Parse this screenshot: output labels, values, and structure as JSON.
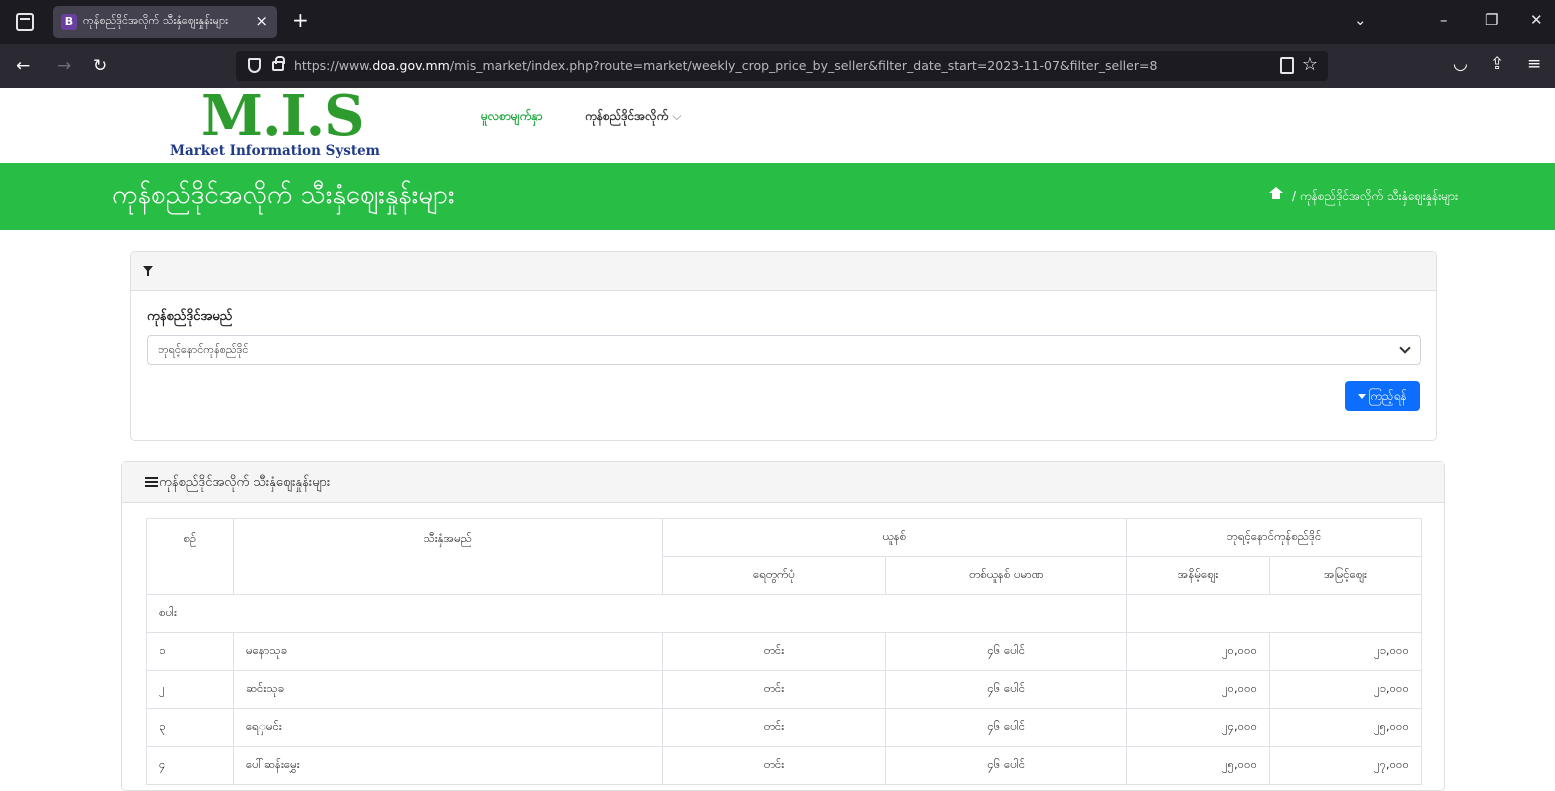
{
  "browser": {
    "tab_favicon": "B",
    "tab_title": "ကုန်စည်ဒိုင်အလိုက် သီးနှံဈေးနှုန်းများ",
    "url_prefix": "https://www.",
    "url_domain": "doa.gov.mm",
    "url_rest": "/mis_market/index.php?route=market/weekly_crop_price_by_seller&filter_date_start=2023-11-07&filter_seller=8"
  },
  "site": {
    "logo_big": "M.I.S",
    "logo_small": "Market Information System",
    "menu": [
      {
        "label": "မူလစာမျက်နှာ"
      },
      {
        "label": "ကုန်စည်ဒိုင်အလိုက်"
      }
    ],
    "page_title": "ကုန်စည်ဒိုင်အလိုက် သီးနှံဈေးနှုန်းများ",
    "breadcrumb_current": "ကုန်စည်ဒိုင်အလိုက် သီးနှံဈေးနှုန်းများ"
  },
  "filter": {
    "label": "ကုန်စည်ဒိုင်အမည်",
    "selected": "ဘုရင့်နောင်ကုန်စည်ဒိုင်",
    "button_label": "ကြည့်ရန်"
  },
  "table": {
    "title": "ကုန်စည်ဒိုင်အလိုက် သီးနှံဈေးနှုန်းများ",
    "headers": {
      "no": "စဉ်",
      "crop": "သီးနှံအမည်",
      "unit_group": "ယူနစ်",
      "market_group": "ဘုရင့်နောင်ကုန်စည်ဒိုင်",
      "unit_type": "ရေတွက်ပုံ",
      "unit_measure": "တစ်ယူနစ် ပမာဏ",
      "min_price": "အနိမ့်ဈေး",
      "max_price": "အမြင့်ဈေး"
    },
    "category": "စပါး",
    "rows": [
      {
        "no": "၁",
        "crop": "မနောသုခ",
        "unit": "တင်း",
        "measure": "၄၆ ပေါင်",
        "min": "၂၀,၀၀၀",
        "max": "၂၁,၀၀၀"
      },
      {
        "no": "၂",
        "crop": "ဆင်းသုခ",
        "unit": "တင်း",
        "measure": "၄၆ ပေါင်",
        "min": "၂၀,၀၀၀",
        "max": "၂၁,၀၀၀"
      },
      {
        "no": "၃",
        "crop": "ရေှမင်း",
        "unit": "တင်း",
        "measure": "၄၆ ပေါင်",
        "min": "၂၄,၀၀၀",
        "max": "၂၅,၀၀၀"
      },
      {
        "no": "၄",
        "crop": "ပေါ်ဆန်းမွှေး",
        "unit": "တင်း",
        "measure": "၄၆ ပေါင်",
        "min": "၂၅,၀၀၀",
        "max": "၂၇,၀၀၀"
      }
    ]
  },
  "colors": {
    "banner_green": "#28bd44",
    "primary_blue": "#0d6efd",
    "logo_green": "#2e9b2e",
    "logo_navy": "#1f3b86"
  }
}
